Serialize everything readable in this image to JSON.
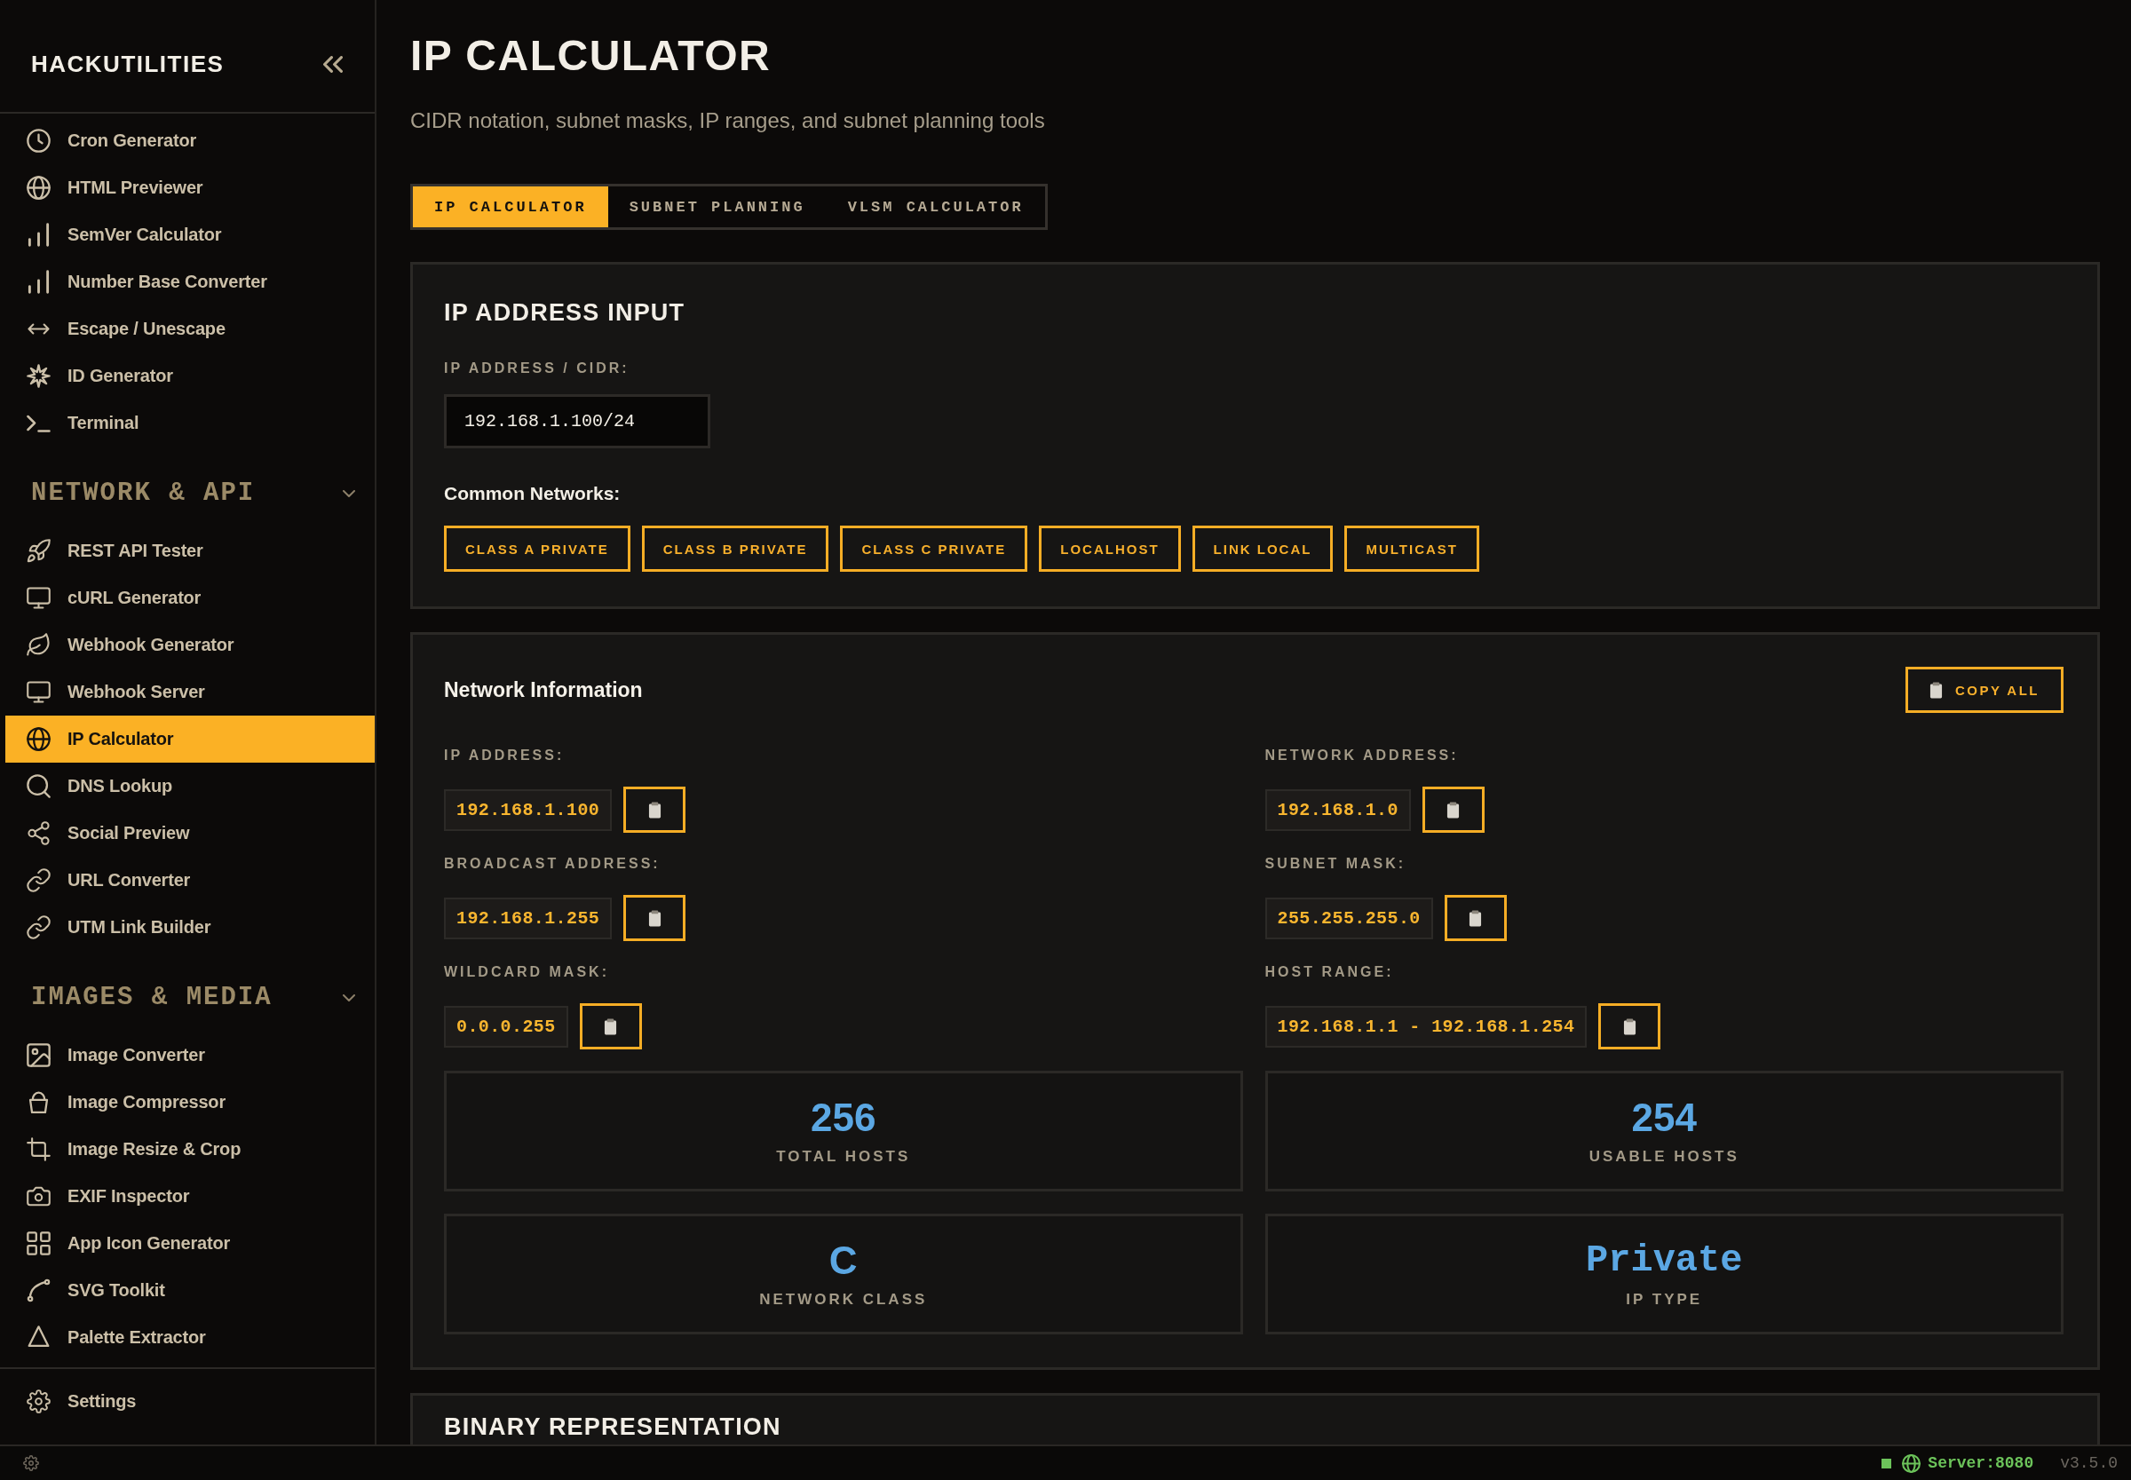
{
  "sidebar": {
    "title": "HACKUTILITIES",
    "groups": [
      {
        "items": [
          {
            "label": "Cron Generator",
            "selected": false
          },
          {
            "label": "HTML Previewer",
            "selected": false
          },
          {
            "label": "SemVer Calculator",
            "selected": false
          },
          {
            "label": "Number Base Converter",
            "selected": false
          },
          {
            "label": "Escape / Unescape",
            "selected": false
          },
          {
            "label": "ID Generator",
            "selected": false
          },
          {
            "label": "Terminal",
            "selected": false
          }
        ]
      },
      {
        "title": "NETWORK & API",
        "expanded": true,
        "items": [
          {
            "label": "REST API Tester",
            "selected": false
          },
          {
            "label": "cURL Generator",
            "selected": false
          },
          {
            "label": "Webhook Generator",
            "selected": false
          },
          {
            "label": "Webhook Server",
            "selected": false
          },
          {
            "label": "IP Calculator",
            "selected": true
          },
          {
            "label": "DNS Lookup",
            "selected": false
          },
          {
            "label": "Social Preview",
            "selected": false
          },
          {
            "label": "URL Converter",
            "selected": false
          },
          {
            "label": "UTM Link Builder",
            "selected": false
          }
        ]
      },
      {
        "title": "IMAGES & MEDIA",
        "expanded": true,
        "items": [
          {
            "label": "Image Converter",
            "selected": false
          },
          {
            "label": "Image Compressor",
            "selected": false
          },
          {
            "label": "Image Resize & Crop",
            "selected": false
          },
          {
            "label": "EXIF Inspector",
            "selected": false
          },
          {
            "label": "App Icon Generator",
            "selected": false
          },
          {
            "label": "SVG Toolkit",
            "selected": false
          },
          {
            "label": "Palette Extractor",
            "selected": false
          }
        ]
      }
    ],
    "footer": {
      "label": "Settings"
    }
  },
  "page": {
    "title": "IP CALCULATOR",
    "subtitle": "CIDR notation, subnet masks, IP ranges, and subnet planning tools"
  },
  "tabs": [
    {
      "label": "IP CALCULATOR",
      "selected": true
    },
    {
      "label": "SUBNET PLANNING",
      "selected": false
    },
    {
      "label": "VLSM CALCULATOR",
      "selected": false
    }
  ],
  "input_panel": {
    "title": "IP ADDRESS INPUT",
    "field_label": "IP ADDRESS / CIDR:",
    "value": "192.168.1.100/24",
    "presets_label": "Common Networks:",
    "presets": [
      "CLASS A PRIVATE",
      "CLASS B PRIVATE",
      "CLASS C PRIVATE",
      "LOCALHOST",
      "LINK LOCAL",
      "MULTICAST"
    ]
  },
  "network_info": {
    "title": "Network Information",
    "copy_all": "COPY ALL",
    "fields": [
      {
        "label": "IP ADDRESS:",
        "value": "192.168.1.100"
      },
      {
        "label": "NETWORK ADDRESS:",
        "value": "192.168.1.0"
      },
      {
        "label": "BROADCAST ADDRESS:",
        "value": "192.168.1.255"
      },
      {
        "label": "SUBNET MASK:",
        "value": "255.255.255.0"
      },
      {
        "label": "WILDCARD MASK:",
        "value": "0.0.0.255"
      },
      {
        "label": "HOST RANGE:",
        "value": "192.168.1.1 - 192.168.1.254"
      }
    ],
    "stats": [
      {
        "kind": "number",
        "value": "256",
        "label": "TOTAL HOSTS"
      },
      {
        "kind": "number",
        "value": "254",
        "label": "USABLE HOSTS"
      },
      {
        "kind": "letter",
        "value": "C",
        "label": "NETWORK CLASS"
      },
      {
        "kind": "word",
        "value": "Private",
        "label": "IP TYPE"
      }
    ]
  },
  "binary_panel": {
    "title": "BINARY REPRESENTATION"
  },
  "status_bar": {
    "connected": true,
    "server": "Server:8080",
    "version": "v3.5.0"
  }
}
